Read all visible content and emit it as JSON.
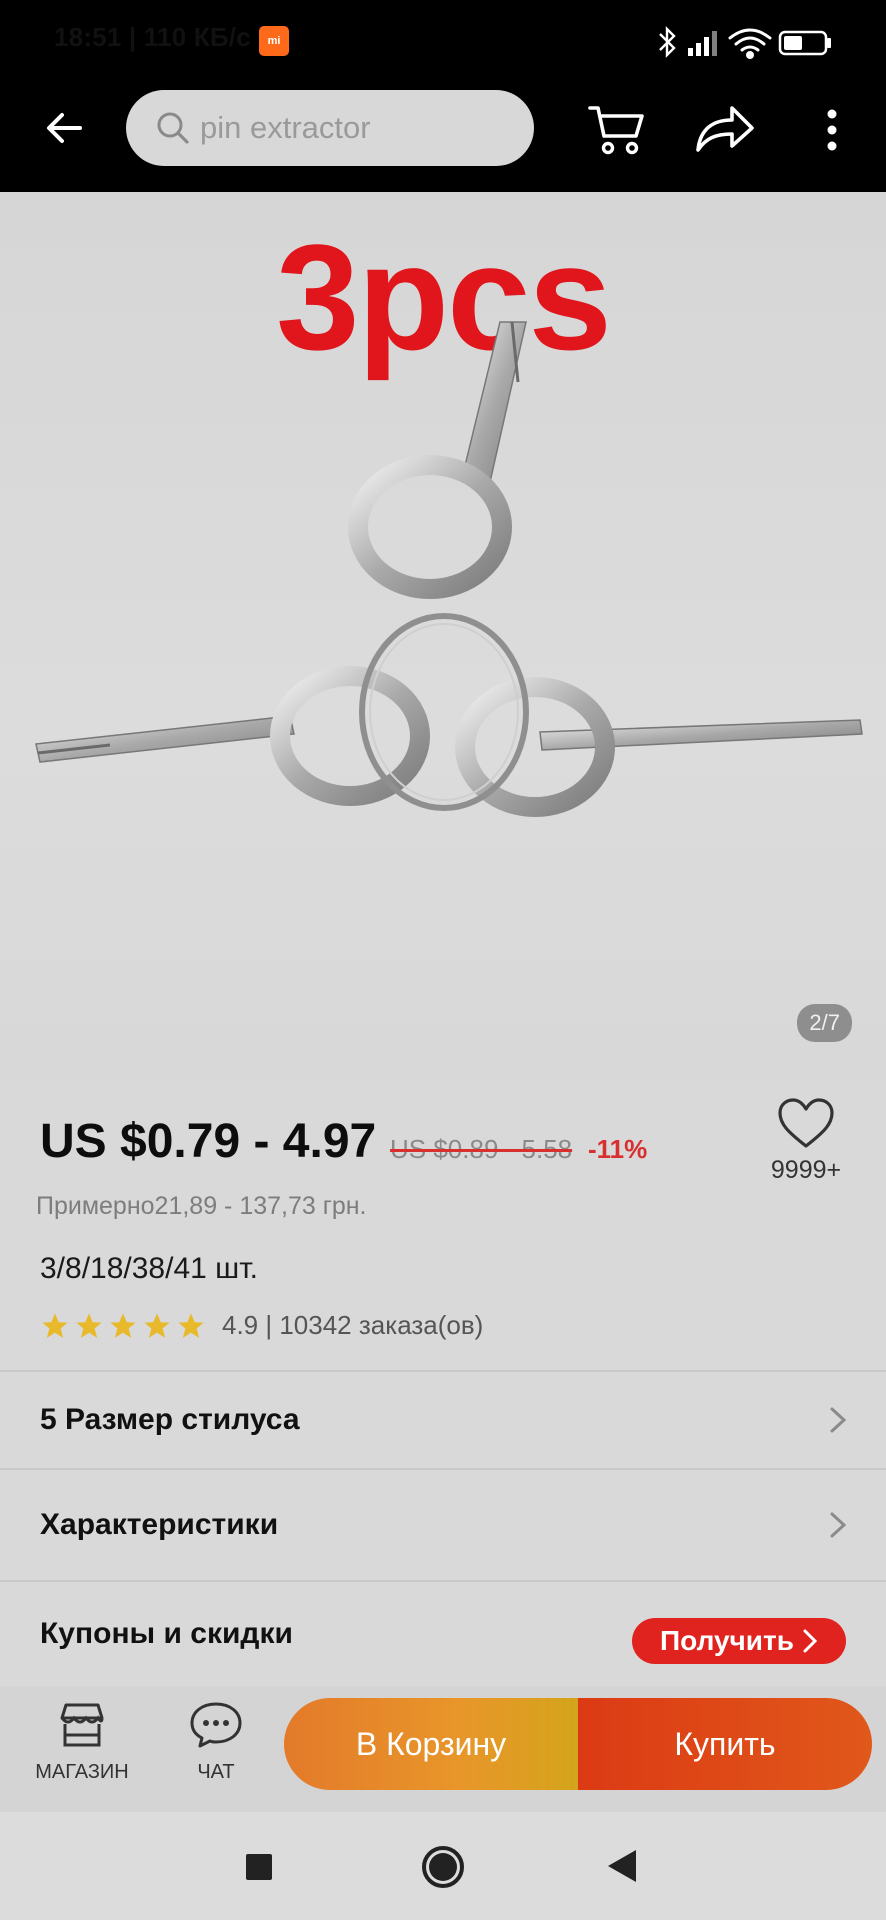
{
  "status_bar": {
    "time_speed": "18:51 | 110 КБ/с",
    "mi_badge": "mi"
  },
  "search": {
    "placeholder": "pin extractor"
  },
  "product_image": {
    "caption": "3pcs",
    "counter": "2/7"
  },
  "price": {
    "main": "US $0.79 - 4.97",
    "old": "US $0.89 - 5.58",
    "discount": "-11%",
    "approx": "Примерно21,89 - 137,73 грн."
  },
  "wishlist": {
    "count": "9999+"
  },
  "quantity": "3/8/18/38/41 шт.",
  "rating": {
    "stars": 5,
    "text": "4.9 | 10342 заказа(ов)",
    "star_color": "#e8b92a"
  },
  "rows": {
    "size": "5 Размер стилуса",
    "specs": "Характеристики",
    "coupons": "Купоны и скидки",
    "coupon_button": "Получить"
  },
  "bottom_bar": {
    "store_label": "МАГАЗИН",
    "chat_label": "ЧАТ",
    "add_to_cart": "В Корзину",
    "buy": "Купить"
  },
  "colors": {
    "accent_red": "#e0231f",
    "caption_red": "#e0161c"
  }
}
